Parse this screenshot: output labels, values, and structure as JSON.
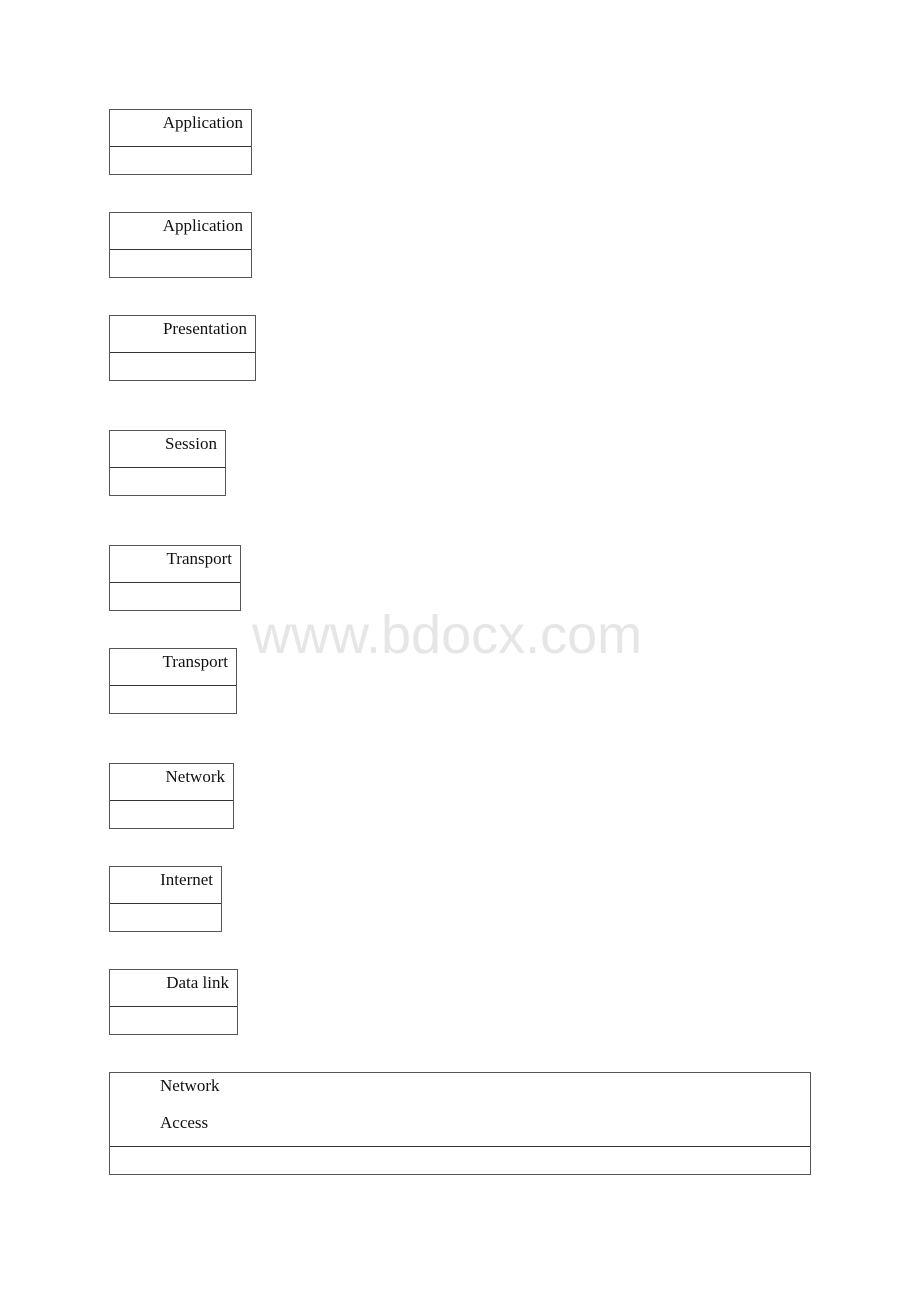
{
  "layers": [
    {
      "label": "Application"
    },
    {
      "label": "Application"
    },
    {
      "label": "Presentation"
    },
    {
      "label": "Session"
    },
    {
      "label": "Transport"
    },
    {
      "label": "Transport"
    },
    {
      "label": "Network"
    },
    {
      "label": "Internet"
    },
    {
      "label": "Data link"
    }
  ],
  "network_access": {
    "line1": "Network",
    "line2": "Access"
  },
  "watermark": "www.bdocx.com"
}
